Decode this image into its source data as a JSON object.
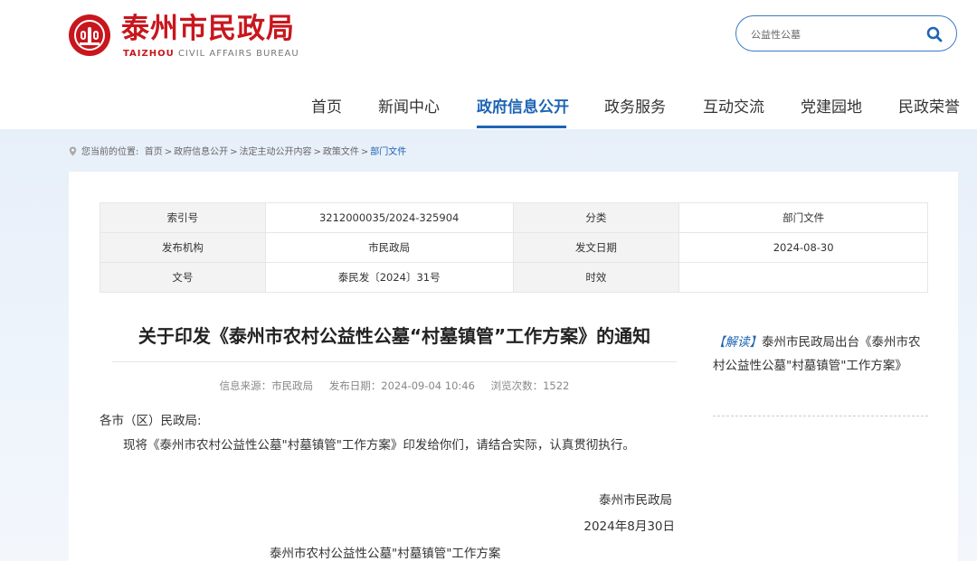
{
  "header": {
    "site_title": "泰州市民政局",
    "site_sub_bold": "TAIZHOU",
    "site_sub_rest": "CIVIL AFFAIRS BUREAU",
    "brand_color": "#c8161d",
    "accent_color": "#1e64b4"
  },
  "search": {
    "placeholder": "公益性公墓",
    "icon": "search-icon"
  },
  "nav": {
    "items": [
      {
        "label": "首页"
      },
      {
        "label": "新闻中心"
      },
      {
        "label": "政府信息公开",
        "active": true
      },
      {
        "label": "政务服务"
      },
      {
        "label": "互动交流"
      },
      {
        "label": "党建园地"
      },
      {
        "label": "民政荣誉"
      }
    ]
  },
  "breadcrumb": {
    "prefix": "您当前的位置:",
    "items": [
      "首页",
      "政府信息公开",
      "法定主动公开内容",
      "政策文件",
      "部门文件"
    ],
    "separator": ">"
  },
  "meta": {
    "rows": [
      [
        "索引号",
        "3212000035/2024-325904",
        "分类",
        "部门文件"
      ],
      [
        "发布机构",
        "市民政局",
        "发文日期",
        "2024-08-30"
      ],
      [
        "文号",
        "泰民发〔2024〕31号",
        "时效",
        ""
      ]
    ]
  },
  "article": {
    "title": "关于印发《泰州市农村公益性公墓“村墓镇管”工作方案》的通知",
    "source": "信息来源：市民政局",
    "date": "发布日期：2024-09-04 10:46",
    "views": "浏览次数：1522",
    "salutation": "各市（区）民政局:",
    "paragraph": "现将《泰州市农村公益性公墓\"村墓镇管\"工作方案》印发给你们，请结合实际，认真贯彻执行。",
    "sign_org": "泰州市民政局",
    "sign_date": "2024年8月30日",
    "sub_title": "泰州市农村公益性公墓\"村墓镇管\"工作方案"
  },
  "sidebar": {
    "tag": "【解读】",
    "text": "泰州市民政局出台《泰州市农村公益性公墓\"村墓镇管\"工作方案》"
  }
}
